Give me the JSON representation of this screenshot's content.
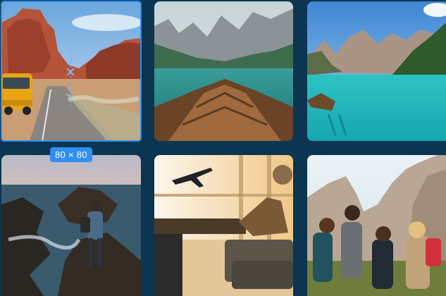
{
  "gallery": {
    "tiles": [
      {
        "icon": "desert-road-van-photo"
      },
      {
        "icon": "boat-bow-lake-photo"
      },
      {
        "icon": "turquoise-mountain-lake-photo"
      },
      {
        "icon": "coastal-rock-hiker-photo"
      },
      {
        "icon": "airport-traveler-photo"
      },
      {
        "icon": "hiking-friends-photo"
      }
    ],
    "selected_index": 0
  },
  "selection": {
    "size_label": "80 × 80"
  },
  "colors": {
    "background": "#0b3550",
    "accent": "#2f8ff2"
  }
}
